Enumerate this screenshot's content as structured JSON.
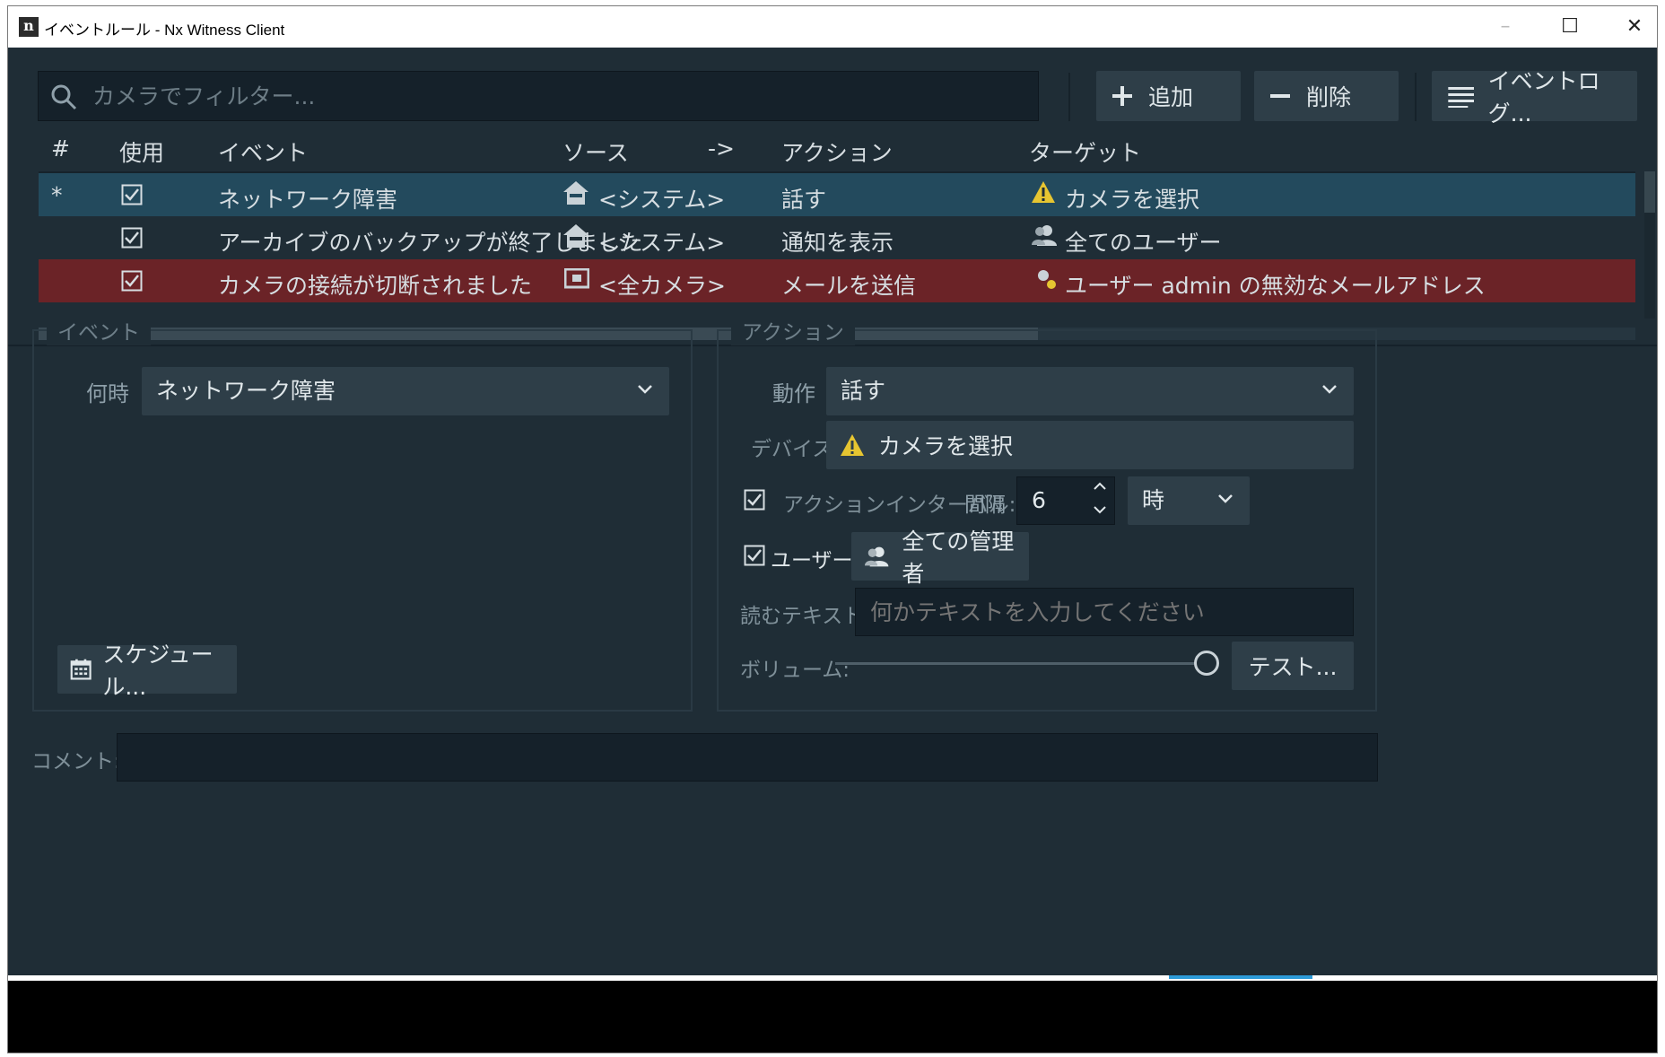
{
  "window": {
    "title": "イベントルール - Nx Witness Client",
    "app_icon_letter": "n"
  },
  "toolbar": {
    "search_placeholder": "カメラでフィルター...",
    "add_label": "追加",
    "delete_label": "削除",
    "event_log_label": "イベントログ..."
  },
  "table": {
    "headers": {
      "num": "#",
      "enabled": "使用",
      "event": "イベント",
      "source": "ソース",
      "arrow": "->",
      "action": "アクション",
      "target": "ターゲット"
    },
    "rows": [
      {
        "num": "*",
        "event": "ネットワーク障害",
        "source": "<システム>",
        "action": "話す",
        "target": "カメラを選択",
        "state": "selected"
      },
      {
        "num": "",
        "event": "アーカイブのバックアップが終了しました",
        "source": "<システム>",
        "action": "通知を表示",
        "target": "全てのユーザー",
        "state": "normal"
      },
      {
        "num": "",
        "event": "カメラの接続が切断されました",
        "source": "<全カメラ>",
        "action": "メールを送信",
        "target": "ユーザー admin の無効なメールアドレス",
        "state": "error"
      }
    ]
  },
  "event_panel": {
    "title": "イベント",
    "when_label": "何時",
    "when_value": "ネットワーク障害",
    "schedule_label": "スケジュール..."
  },
  "action_panel": {
    "title": "アクション",
    "action_label": "動作",
    "action_value": "話す",
    "device_label": "デバイス",
    "device_value": "カメラを選択",
    "interval_label": "アクションインターバル:",
    "interval_every": "間隔",
    "interval_value": "6",
    "interval_unit": "時",
    "users_label": "ユーザー",
    "users_value": "全ての管理者",
    "text_label": "読むテキスト:",
    "text_placeholder": "何かテキストを入力してください",
    "volume_label": "ボリューム:",
    "volume_level": 1.0,
    "test_label": "テスト..."
  },
  "comment": {
    "label": "コメント:"
  },
  "colors": {
    "background": "#1f2d36",
    "selected_row": "#234a5d",
    "error_row": "#6b2327",
    "warning": "#e6c531",
    "accent": "#2d9bd8"
  }
}
